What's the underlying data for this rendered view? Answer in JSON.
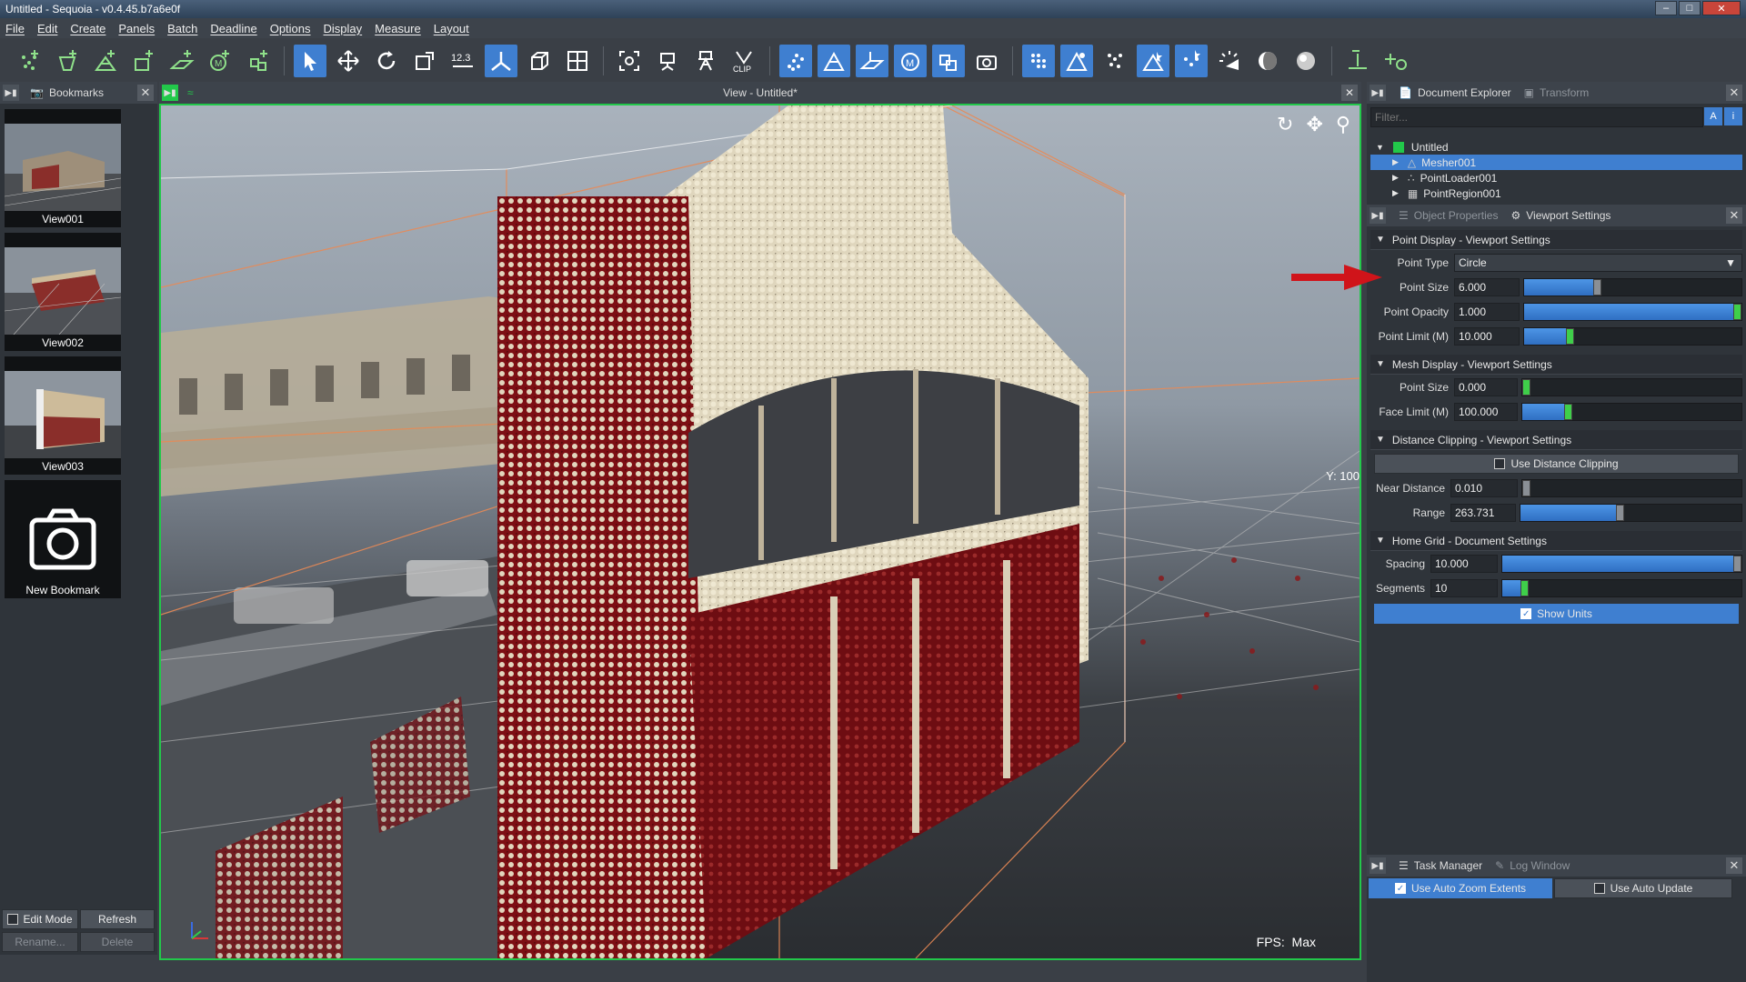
{
  "window": {
    "title": "Untitled - Sequoia - v0.4.45.b7a6e0f"
  },
  "menu": [
    "File",
    "Edit",
    "Create",
    "Panels",
    "Batch",
    "Deadline",
    "Options",
    "Display",
    "Measure",
    "Layout"
  ],
  "toolbar": {
    "number_label": "12.3",
    "clip_label": "CLIP"
  },
  "bookmarks": {
    "panel_title": "Bookmarks",
    "items": [
      {
        "label": "View001"
      },
      {
        "label": "View002"
      },
      {
        "label": "View003"
      }
    ],
    "new_label": "New Bookmark",
    "edit_mode_label": "Edit Mode",
    "refresh_label": "Refresh",
    "rename_label": "Rename...",
    "delete_label": "Delete"
  },
  "viewport": {
    "title": "View - Untitled*",
    "fps_label": "FPS:",
    "fps_value": "Max",
    "axis_readout": "Y: 100"
  },
  "document_explorer": {
    "tab_active": "Document Explorer",
    "tab_inactive": "Transform",
    "filter_placeholder": "Filter...",
    "root": "Untitled",
    "nodes": [
      {
        "label": "Mesher001"
      },
      {
        "label": "PointLoader001"
      },
      {
        "label": "PointRegion001"
      }
    ]
  },
  "settings": {
    "tab_inactive": "Object Properties",
    "tab_active": "Viewport Settings",
    "point_display": {
      "title": "Point Display - Viewport Settings",
      "point_type_label": "Point Type",
      "point_type_value": "Circle",
      "point_size_label": "Point Size",
      "point_size_value": "6.000",
      "point_size_fraction": 0.33,
      "point_opacity_label": "Point Opacity",
      "point_opacity_value": "1.000",
      "point_opacity_fraction": 1.0,
      "point_limit_label": "Point Limit (M)",
      "point_limit_value": "10.000",
      "point_limit_fraction": 0.2
    },
    "mesh_display": {
      "title": "Mesh Display - Viewport Settings",
      "point_size_label": "Point Size",
      "point_size_value": "0.000",
      "point_size_fraction": 0.0,
      "face_limit_label": "Face Limit (M)",
      "face_limit_value": "100.000",
      "face_limit_fraction": 0.2
    },
    "distance_clipping": {
      "title": "Distance Clipping - Viewport Settings",
      "use_label": "Use Distance Clipping",
      "near_label": "Near Distance",
      "near_value": "0.010",
      "near_fraction": 0.0,
      "range_label": "Range",
      "range_value": "263.731",
      "range_fraction": 0.45
    },
    "home_grid": {
      "title": "Home Grid - Document Settings",
      "spacing_label": "Spacing",
      "spacing_value": "10.000",
      "spacing_fraction": 1.0,
      "segments_label": "Segments",
      "segments_value": "10",
      "segments_fraction": 0.08,
      "show_units_label": "Show Units"
    }
  },
  "task_panel": {
    "tab_active": "Task Manager",
    "tab_inactive": "Log Window",
    "auto_zoom_label": "Use Auto Zoom Extents",
    "auto_update_label": "Use Auto Update"
  },
  "colors": {
    "accent": "#3f7fd0",
    "viewport_border": "#22c84a",
    "arrow": "#d0141a"
  }
}
